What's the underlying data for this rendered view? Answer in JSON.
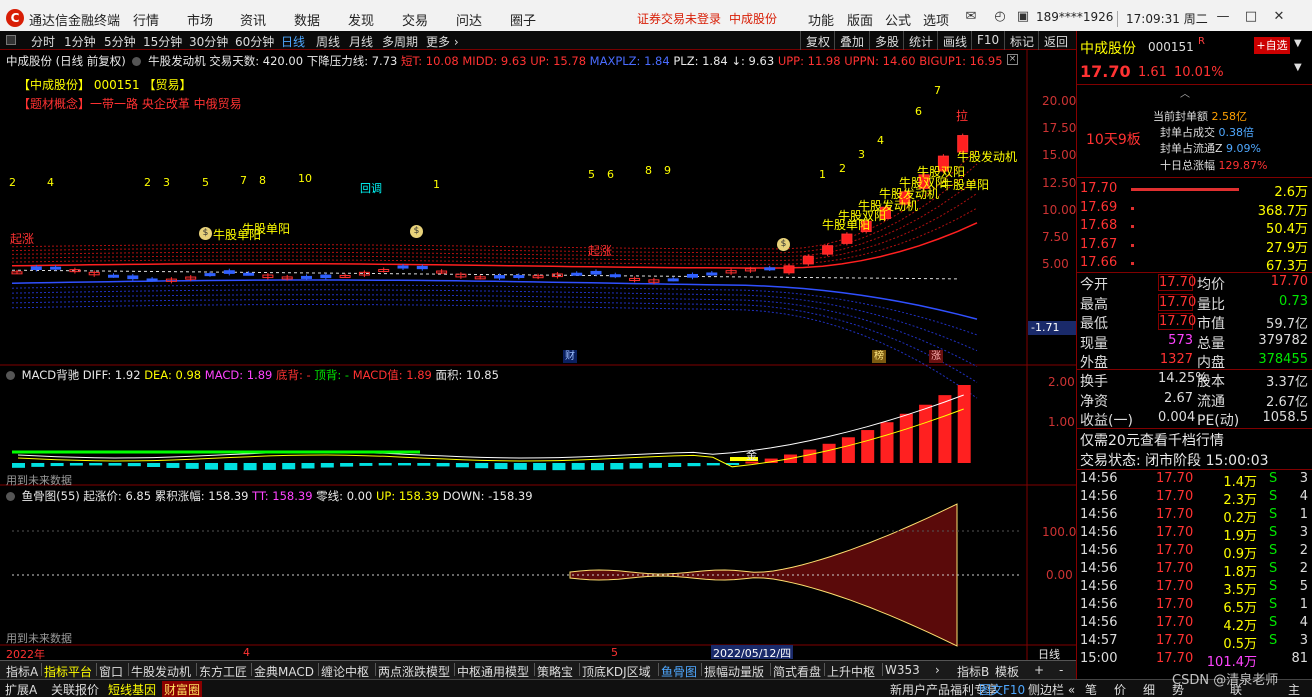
{
  "titlebar": {
    "logo": "C",
    "app_name": "通达信金融终端",
    "menu": [
      "行情",
      "市场",
      "资讯",
      "数据",
      "发现",
      "交易",
      "问达",
      "圈子"
    ],
    "notice_not_logged": "证券交易未登录",
    "notice_stock": "中成股份",
    "right_menu": [
      "功能",
      "版面",
      "公式",
      "选项"
    ],
    "user": "189****1926",
    "time": "17:09:31 周二"
  },
  "periods": [
    "分时",
    "1分钟",
    "5分钟",
    "15分钟",
    "30分钟",
    "60分钟",
    "日线",
    "周线",
    "月线",
    "多周期",
    "更多 ›"
  ],
  "active_period": "日线",
  "tools": [
    "复权",
    "叠加",
    "多股",
    "统计",
    "画线",
    "F10",
    "标记",
    "返回"
  ],
  "main_chart": {
    "title_prefix": "中成股份 (日线 前复权)",
    "indicator_name": "牛股发动机",
    "items": [
      {
        "text": "交易天数: 420.00",
        "color": "white"
      },
      {
        "text": "下降压力线: 7.73",
        "color": "white"
      },
      {
        "text": "短T: 10.08",
        "color": "red"
      },
      {
        "text": "MIDD: 9.63",
        "color": "red"
      },
      {
        "text": "UP: 15.78",
        "color": "red"
      },
      {
        "text": "MAXPLZ: 1.84",
        "color": "blue"
      },
      {
        "text": "PLZ: 1.84",
        "color": "white"
      },
      {
        "text": "↓: 9.63",
        "color": "white"
      },
      {
        "text": "UPP: 11.98",
        "color": "red"
      },
      {
        "text": "UPPN: 14.60",
        "color": "red"
      },
      {
        "text": "BIGUP1: 16.95",
        "color": "red"
      }
    ],
    "stock_tag": "【中成股份】 000151 【贸易】",
    "concept_tag": "【题材概念】一带一路 央企改革 中俄贸易",
    "yaxis": [
      "20.00",
      "17.50",
      "15.00",
      "12.50",
      "10.00",
      "7.50",
      "5.00"
    ],
    "current_marker": "-1.71",
    "labels": {
      "bull_engine": "牛股发动机",
      "bull_double": "牛股双阳",
      "bull_single": "牛股单阳",
      "start": "起涨",
      "pullback": "回调",
      "limit_up": "拉",
      "fin_badge": "财",
      "rank_badge": "榜",
      "rise_badge": "涨"
    },
    "wave_numbers": [
      "2",
      "4",
      "2",
      "3",
      "5",
      "7",
      "8",
      "10",
      "1",
      "5",
      "6",
      "8",
      "9",
      "1",
      "2",
      "3",
      "4",
      "6",
      "7"
    ]
  },
  "macd": {
    "title": "MACD背驰",
    "items": [
      {
        "text": "DIFF: 1.92",
        "color": "white"
      },
      {
        "text": "DEA: 0.98",
        "color": "yellow"
      },
      {
        "text": "MACD: 1.89",
        "color": "magenta"
      },
      {
        "text": "底背: -",
        "color": "red"
      },
      {
        "text": "顶背: -",
        "color": "green"
      },
      {
        "text": "MACD值: 1.89",
        "color": "red"
      },
      {
        "text": "面积: 10.85",
        "color": "white"
      }
    ],
    "yaxis": [
      "2.00",
      "1.00"
    ],
    "note": "用到未来数据",
    "gold_label": "金"
  },
  "fishbone": {
    "title": "鱼骨图(55)",
    "items": [
      {
        "text": "起涨价: 6.85",
        "color": "white"
      },
      {
        "text": "累积涨幅: 158.39",
        "color": "white"
      },
      {
        "text": "TT: 158.39",
        "color": "magenta"
      },
      {
        "text": "零线: 0.00",
        "color": "white"
      },
      {
        "text": "UP: 158.39",
        "color": "yellow"
      },
      {
        "text": "DOWN: -158.39",
        "color": "white"
      }
    ],
    "yaxis": [
      "100.0",
      "0.00"
    ],
    "note": "用到未来数据"
  },
  "xaxis": {
    "labels": [
      "2022年",
      "4",
      "5"
    ],
    "cursor_date": "2022/05/12/四",
    "mode": "日线"
  },
  "right": {
    "name": "中成股份",
    "code": "000151",
    "r_mark": "R",
    "add_fav": "+自选",
    "price": "17.70",
    "change": "1.61",
    "change_pct": "10.01%",
    "limit_info": {
      "streak": "10天9板",
      "rows": [
        {
          "label": "当前封单额",
          "value": "2.58亿"
        },
        {
          "label": "封单占成交",
          "value": "0.38倍"
        },
        {
          "label": "封单占流通Z",
          "value": "9.09%"
        },
        {
          "label": "十日总涨幅",
          "value": "129.87%"
        }
      ]
    },
    "order_book": [
      {
        "price": "17.70",
        "vol": "2.6万",
        "bar": 1.0
      },
      {
        "price": "17.69",
        "vol": "368.7万",
        "bar": 0.02
      },
      {
        "price": "17.68",
        "vol": "50.4万",
        "bar": 0.02
      },
      {
        "price": "17.67",
        "vol": "27.9万",
        "bar": 0.02
      },
      {
        "price": "17.66",
        "vol": "67.3万",
        "bar": 0.02
      }
    ],
    "stats_a": [
      {
        "l1": "今开",
        "v1": "17.70",
        "l2": "均价",
        "v2": "17.70"
      },
      {
        "l1": "最高",
        "v1": "17.70",
        "l2": "量比",
        "v2": "0.73"
      },
      {
        "l1": "最低",
        "v1": "17.70",
        "l2": "市值",
        "v2": "59.7亿"
      },
      {
        "l1": "现量",
        "v1": "573",
        "l2": "总量",
        "v2": "379782"
      },
      {
        "l1": "外盘",
        "v1": "1327",
        "l2": "内盘",
        "v2": "378455"
      }
    ],
    "stats_b": [
      {
        "l1": "换手",
        "v1": "14.25%",
        "l2": "股本",
        "v2": "3.37亿"
      },
      {
        "l1": "净资",
        "v1": "2.67",
        "l2": "流通",
        "v2": "2.67亿"
      },
      {
        "l1": "收益(一)",
        "v1": "0.004",
        "l2": "PE(动)",
        "v2": "1058.5"
      }
    ],
    "promo": "仅需20元查看千档行情",
    "trade_status_label": "交易状态: 闭市阶段",
    "trade_status_time": "15:00:03",
    "ticks": [
      {
        "t": "14:56",
        "p": "17.70",
        "v": "1.4万",
        "s": "S",
        "n": "3"
      },
      {
        "t": "14:56",
        "p": "17.70",
        "v": "2.3万",
        "s": "S",
        "n": "4"
      },
      {
        "t": "14:56",
        "p": "17.70",
        "v": "0.2万",
        "s": "S",
        "n": "1"
      },
      {
        "t": "14:56",
        "p": "17.70",
        "v": "1.9万",
        "s": "S",
        "n": "3"
      },
      {
        "t": "14:56",
        "p": "17.70",
        "v": "0.9万",
        "s": "S",
        "n": "2"
      },
      {
        "t": "14:56",
        "p": "17.70",
        "v": "1.8万",
        "s": "S",
        "n": "2"
      },
      {
        "t": "14:56",
        "p": "17.70",
        "v": "3.5万",
        "s": "S",
        "n": "5"
      },
      {
        "t": "14:56",
        "p": "17.70",
        "v": "6.5万",
        "s": "S",
        "n": "1"
      },
      {
        "t": "14:56",
        "p": "17.70",
        "v": "4.2万",
        "s": "S",
        "n": "4"
      },
      {
        "t": "14:57",
        "p": "17.70",
        "v": "0.5万",
        "s": "S",
        "n": "3"
      },
      {
        "t": "15:00",
        "p": "17.70",
        "v": "101.4万",
        "s": "",
        "n": "81"
      }
    ]
  },
  "bottom_tabs": [
    "指标A",
    "指标平台",
    "窗口",
    "牛股发动机",
    "东方工匠",
    "金典MACD",
    "缠论中枢",
    "两点涨跌模型",
    "中枢通用模型",
    "策略宝",
    "顶底KDJ区域",
    "鱼骨图",
    "振幅动量版",
    "简式看盘",
    "上升中枢",
    "W353"
  ],
  "bottom_tabs_right": [
    "指标B",
    "模板",
    "+",
    "-"
  ],
  "status_tabs": [
    "扩展A",
    "关联报价",
    "短线基因",
    "财富圈"
  ],
  "status_right": [
    "新用户产品福利专享",
    "图文F10",
    "侧边栏 «",
    "笔",
    "价",
    "细",
    "势",
    "联",
    "主"
  ],
  "watermark": "CSDN @清泉老师",
  "colors": {
    "up": "#ff3232",
    "down": "#00ffff",
    "accent_blue": "#4a6cff",
    "yellow": "#ffff00"
  }
}
